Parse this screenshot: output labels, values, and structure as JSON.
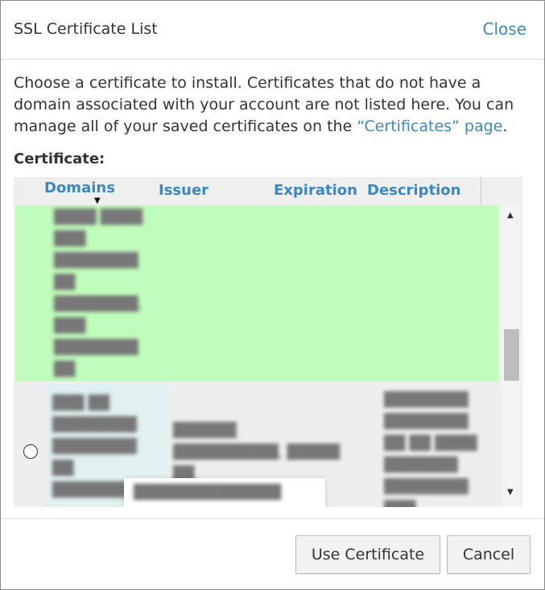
{
  "dialog": {
    "title": "SSL Certificate List",
    "close_label": "Close",
    "intro_text": "Choose a certificate to install. Certificates that do not have a domain associated with your account are not listed here. You can manage all of your saved certificates on the ",
    "intro_link": "“Certificates” page",
    "intro_end": ".",
    "certificate_label": "Certificate:"
  },
  "table": {
    "columns": [
      "Domains",
      "Issuer",
      "Expiration",
      "Description"
    ],
    "sort_indicator": "▼"
  },
  "rows": [
    {
      "domains": "blurred",
      "selected": true
    },
    {
      "domains": "blurred",
      "selected": false
    }
  ],
  "scrollbar": {
    "up": "▲",
    "down": "▼"
  },
  "footer": {
    "use_label": "Use Certificate",
    "cancel_label": "Cancel"
  },
  "colors": {
    "accent": "#3b88c3",
    "selected_row": "#c0fcbc",
    "domain_cell": "#e1f0f0"
  }
}
